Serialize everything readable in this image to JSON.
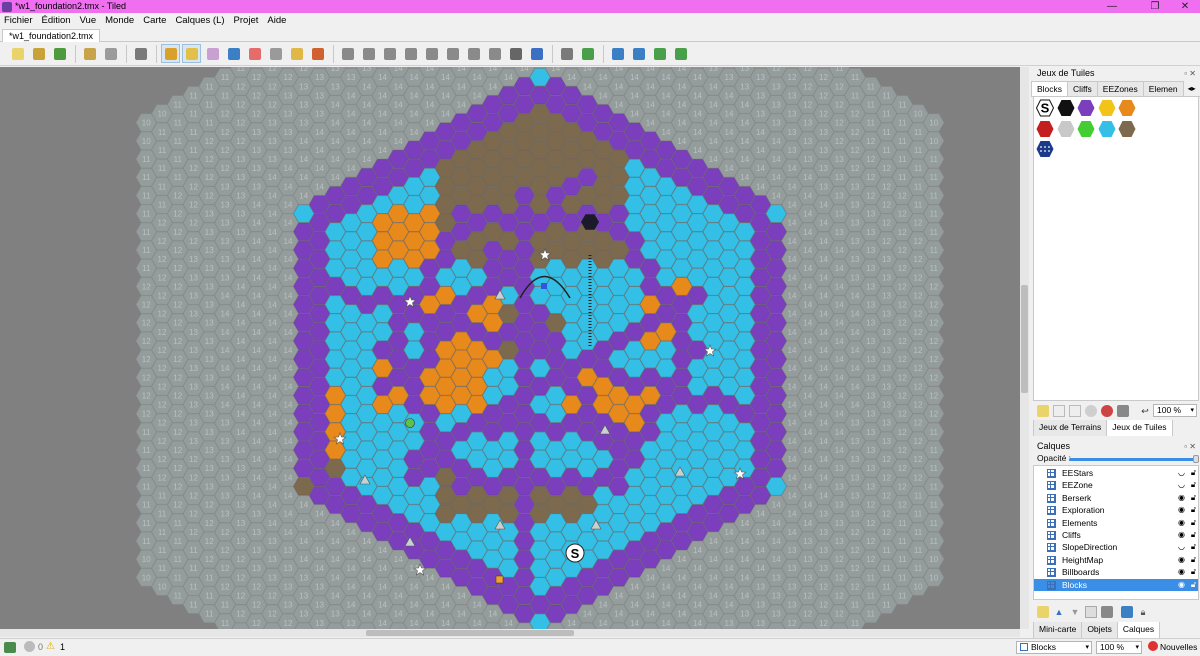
{
  "titlebar": {
    "title": "*w1_foundation2.tmx - Tiled",
    "bg": "#f06ef0",
    "min": "—",
    "max": "❐",
    "close": "✕"
  },
  "menu": [
    "Fichier",
    "Édition",
    "Vue",
    "Monde",
    "Carte",
    "Calques (L)",
    "Projet",
    "Aide"
  ],
  "tab": {
    "label": "*w1_foundation2.tmx",
    "close": "✕"
  },
  "toolbar": [
    {
      "name": "new-map",
      "color": "#e9d36a"
    },
    {
      "name": "open",
      "color": "#c9a33a"
    },
    {
      "name": "save",
      "color": "#4f9a3c"
    },
    {
      "sep": true
    },
    {
      "name": "undo",
      "color": "#c7a44a"
    },
    {
      "name": "redo",
      "color": "#9b9b9b"
    },
    {
      "sep": true
    },
    {
      "name": "commands",
      "color": "#7a7a7a"
    },
    {
      "sep": true
    },
    {
      "name": "stamp-brush",
      "color": "#d9a02a",
      "active": true
    },
    {
      "name": "terrain-brush",
      "color": "#e2c04a",
      "active": true
    },
    {
      "name": "bucket-fill",
      "color": "#c9a0d2"
    },
    {
      "name": "shape-fill",
      "color": "#3b7fc4"
    },
    {
      "name": "eraser",
      "color": "#e66b6b"
    },
    {
      "name": "rect-select",
      "color": "#9a9a9a"
    },
    {
      "name": "magic-wand",
      "color": "#e0b84a"
    },
    {
      "name": "select-same",
      "color": "#d06030"
    },
    {
      "sep": true
    },
    {
      "name": "select-objects",
      "color": "#8a8a8a"
    },
    {
      "name": "edit-polygons",
      "color": "#8a8a8a"
    },
    {
      "name": "insert-rect",
      "color": "#8a8a8a"
    },
    {
      "name": "insert-point",
      "color": "#8a8a8a"
    },
    {
      "name": "insert-ellipse",
      "color": "#8a8a8a"
    },
    {
      "name": "insert-polygon",
      "color": "#8a8a8a"
    },
    {
      "name": "insert-tile",
      "color": "#8a8a8a"
    },
    {
      "name": "insert-template",
      "color": "#8a8a8a"
    },
    {
      "name": "insert-text",
      "color": "#666666"
    },
    {
      "name": "move-tool",
      "color": "#3b6fc4"
    },
    {
      "sep": true
    },
    {
      "name": "random-mode",
      "color": "#7a7a7a"
    },
    {
      "name": "wang-fill",
      "color": "#4aa04a"
    },
    {
      "sep": true
    },
    {
      "name": "flip-h",
      "color": "#3b7fc4"
    },
    {
      "name": "flip-v",
      "color": "#3b7fc4"
    },
    {
      "name": "rotate-left",
      "color": "#4aa04a"
    },
    {
      "name": "rotate-right",
      "color": "#4aa04a"
    }
  ],
  "map": {
    "bg": "#808080",
    "fog_color": "#9aa3a3",
    "water": "#33bfe6",
    "road": "#7b3fbe",
    "orange": "#e8891c",
    "dirt": "#7d6a4e",
    "fog_numbers": [
      "14",
      "13",
      "12",
      "11",
      "10",
      "9",
      "14"
    ],
    "start_marker": "S"
  },
  "tilesets_panel": {
    "title": "Jeux de Tuiles",
    "tabs": [
      "Blocks",
      "Cliffs",
      "EEZones",
      "Elemen"
    ],
    "tiles": [
      {
        "kind": "start",
        "color": "#ffffff",
        "label": "S"
      },
      {
        "kind": "hex",
        "color": "#111111"
      },
      {
        "kind": "hex",
        "color": "#7b3fbe"
      },
      {
        "kind": "hex",
        "color": "#f2c418"
      },
      {
        "kind": "hex",
        "color": "#e8891c"
      },
      {
        "kind": "hex",
        "color": "#c41e1e"
      },
      {
        "kind": "hex",
        "color": "#c8c8c8"
      },
      {
        "kind": "hex",
        "color": "#44cc33"
      },
      {
        "kind": "hex",
        "color": "#33bfe6"
      },
      {
        "kind": "hex",
        "color": "#7d6a4e"
      },
      {
        "kind": "hex",
        "color": "#1b3a8a"
      }
    ],
    "zoom": "100 %",
    "bottom_tabs": [
      "Jeux de Terrains",
      "Jeux de Tuiles"
    ]
  },
  "layers_panel": {
    "title": "Calques",
    "opacity_label": "Opacité :",
    "opacity": 1,
    "layers": [
      "EEStars",
      "EEZone",
      "Berserk",
      "Exploration",
      "Elements",
      "Cliffs",
      "SlopeDirection",
      "HeightMap",
      "Billboards",
      "Blocks"
    ],
    "selected": "Blocks",
    "hidden": [
      "EEStars",
      "EEZone",
      "SlopeDirection"
    ],
    "bottom_tabs": [
      "Mini-carte",
      "Objets",
      "Calques"
    ]
  },
  "statusbar": {
    "errors": "0",
    "warnings": "1",
    "layer": "Blocks",
    "zoom": "100 %",
    "news": "Nouvelles"
  }
}
